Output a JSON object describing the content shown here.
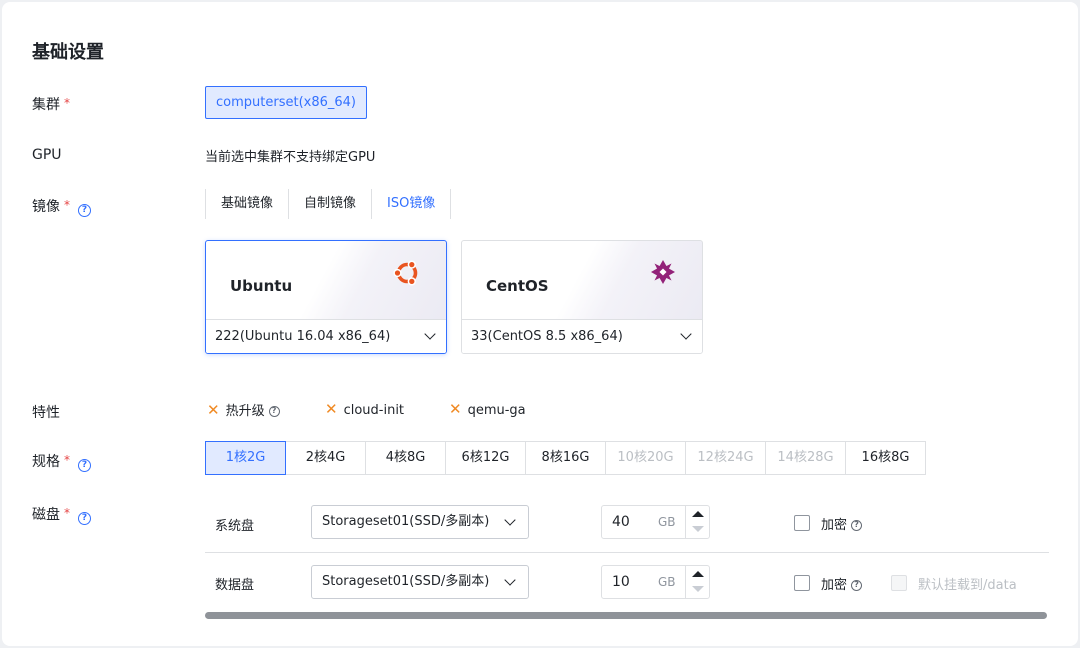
{
  "section_title": "基础设置",
  "cluster": {
    "label": "集群",
    "value": "computerset(x86_64)"
  },
  "gpu": {
    "label": "GPU",
    "text": "当前选中集群不支持绑定GPU"
  },
  "image": {
    "label": "镜像",
    "tabs": [
      {
        "label": "基础镜像",
        "active": false
      },
      {
        "label": "自制镜像",
        "active": false
      },
      {
        "label": "ISO镜像",
        "active": true
      }
    ],
    "os_cards": [
      {
        "name": "Ubuntu",
        "version": "222(Ubuntu 16.04 x86_64)",
        "selected": true,
        "logo": "ubuntu-logo-icon"
      },
      {
        "name": "CentOS",
        "version": "33(CentOS 8.5 x86_64)",
        "selected": false,
        "logo": "centos-logo-icon"
      }
    ]
  },
  "features": {
    "label": "特性",
    "items": [
      "热升级",
      "cloud-init",
      "qemu-ga"
    ]
  },
  "spec": {
    "label": "规格",
    "options": [
      {
        "label": "1核2G",
        "state": "active"
      },
      {
        "label": "2核4G",
        "state": "normal"
      },
      {
        "label": "4核8G",
        "state": "normal"
      },
      {
        "label": "6核12G",
        "state": "normal"
      },
      {
        "label": "8核16G",
        "state": "normal"
      },
      {
        "label": "10核20G",
        "state": "disabled"
      },
      {
        "label": "12核24G",
        "state": "disabled"
      },
      {
        "label": "14核28G",
        "state": "disabled"
      },
      {
        "label": "16核8G",
        "state": "normal"
      }
    ]
  },
  "disk": {
    "label": "磁盘",
    "system": {
      "label": "系统盘",
      "storage": "Storageset01(SSD/多副本)",
      "size": "40",
      "unit": "GB",
      "encrypt": "加密"
    },
    "data": {
      "label": "数据盘",
      "storage": "Storageset01(SSD/多副本)",
      "size": "10",
      "unit": "GB",
      "encrypt": "加密",
      "mount": "默认挂载到/data"
    }
  },
  "colors": {
    "primary": "#3370ff",
    "required": "#e54545",
    "feature_x": "#f08a24"
  }
}
